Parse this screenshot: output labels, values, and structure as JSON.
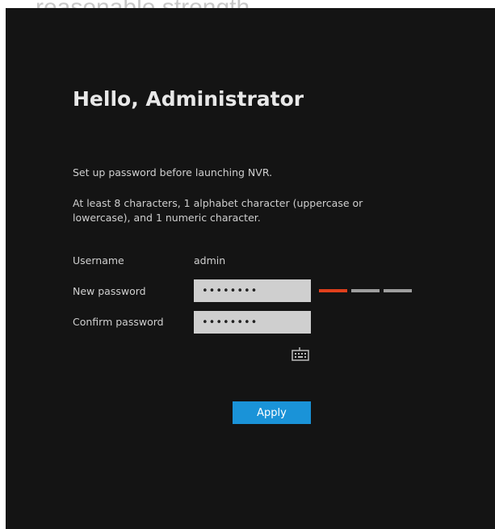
{
  "caption": "reasonable strength.",
  "dialog": {
    "title": "Hello, Administrator",
    "intro": "Set up password before launching NVR.",
    "requirements": "At least 8 characters, 1 alphabet character (uppercase or lowercase), and 1 numeric character.",
    "username_label": "Username",
    "username_value": "admin",
    "new_password_label": "New password",
    "new_password_value": "••••••••",
    "confirm_password_label": "Confirm password",
    "confirm_password_value": "••••••••",
    "strength": {
      "active_segments": 1,
      "total_segments": 3,
      "active_color": "#e0401c",
      "inactive_color": "#9e9e9e"
    },
    "keyboard_icon": "keyboard-icon",
    "apply_label": "Apply",
    "accent_color": "#1a93d8"
  }
}
